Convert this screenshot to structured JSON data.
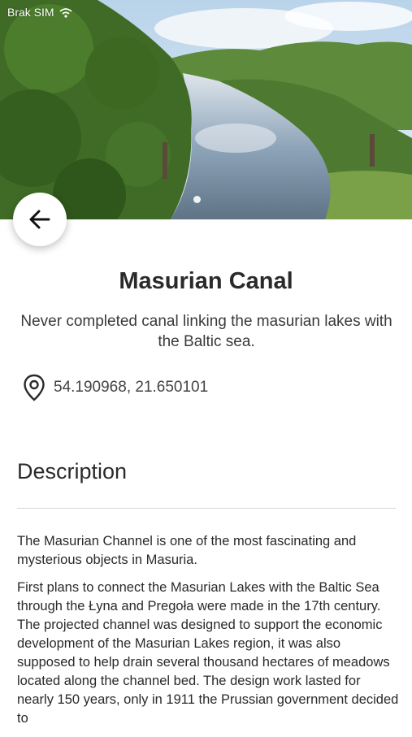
{
  "status_bar": {
    "carrier": "Brak SIM"
  },
  "place": {
    "title": "Masurian Canal",
    "subtitle": "Never completed canal linking the masurian lakes with the Baltic sea.",
    "coordinates": "54.190968, 21.650101"
  },
  "description": {
    "heading": "Description",
    "paragraphs": [
      "The Masurian Channel is one of the most fascinating and mysterious objects in Masuria.",
      "First plans to connect the Masurian Lakes with the Baltic Sea through the Łyna and Pregoła were made in the 17th century. The projected channel was designed to support the economic development of the Masurian Lakes region, it was also supposed to help drain several thousand hectares of meadows located along the channel bed. The design work lasted for nearly 150 years, only in 1911 the Prussian government decided to"
    ]
  },
  "gallery": {
    "current_page": 1
  },
  "icons": {
    "back": "arrow-left-icon",
    "location": "location-pin-icon",
    "wifi": "wifi-icon"
  },
  "colors": {
    "sky": "#cfe2f2",
    "foliage": "#4f7a35",
    "water": "#9fb3c4"
  }
}
